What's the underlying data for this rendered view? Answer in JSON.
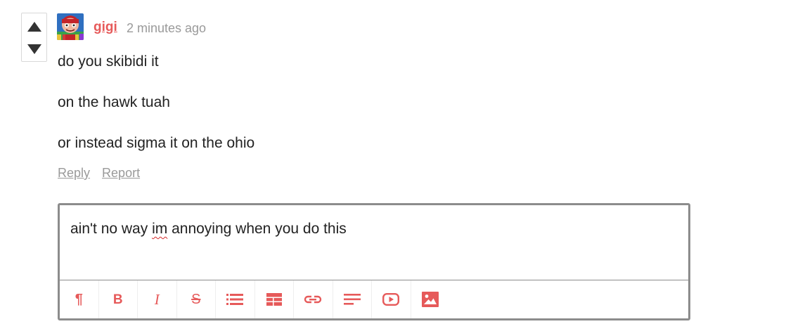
{
  "comment": {
    "username": "gigi",
    "timestamp": "2 minutes ago",
    "lines": [
      "do you skibidi it",
      "on the hawk tuah",
      "or instead sigma it on the ohio"
    ],
    "actions": {
      "reply": "Reply",
      "report": "Report"
    }
  },
  "editor": {
    "text_before": "ain't no way ",
    "misspelled": "im",
    "text_after": " annoying when you do this",
    "toolbar": {
      "paragraph": "¶",
      "bold": "B",
      "italic": "I",
      "strikethrough": "S"
    },
    "toolbar_icons": [
      "paragraph-icon",
      "bold-icon",
      "italic-icon",
      "strikethrough-icon",
      "bulleted-list-icon",
      "table-icon",
      "link-icon",
      "align-icon",
      "video-icon",
      "image-icon"
    ]
  },
  "colors": {
    "accent": "#e65a5a",
    "muted": "#9a9a9a",
    "border": "#8c8c8c"
  }
}
